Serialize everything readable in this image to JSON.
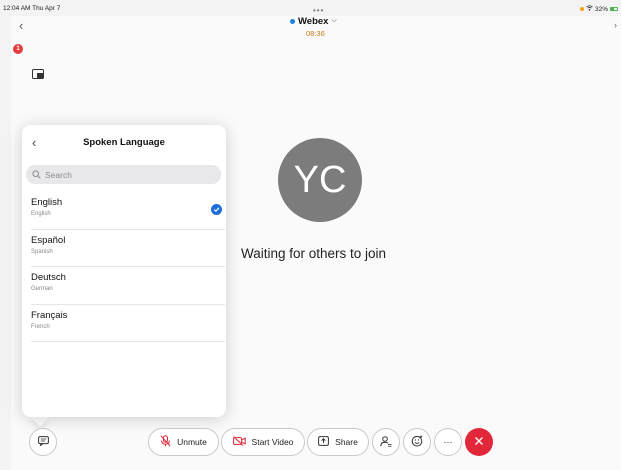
{
  "status_bar": {
    "time": "12:04 AM  Thu Apr 7",
    "battery": "32%"
  },
  "header": {
    "title": "Webex",
    "timer": "08:36",
    "badge_count": "1"
  },
  "center": {
    "avatar_initials": "YC",
    "waiting_text": "Waiting for others to join"
  },
  "language_panel": {
    "title": "Spoken Language",
    "search_placeholder": "Search",
    "languages": [
      {
        "name": "English",
        "sub": "English",
        "selected": true
      },
      {
        "name": "Español",
        "sub": "Spanish",
        "selected": false
      },
      {
        "name": "Deutsch",
        "sub": "German",
        "selected": false
      },
      {
        "name": "Français",
        "sub": "French",
        "selected": false
      }
    ]
  },
  "toolbar": {
    "unmute_label": "Unmute",
    "start_video_label": "Start Video",
    "share_label": "Share",
    "more_label": "···"
  },
  "colors": {
    "accent": "#1c6fd8",
    "end_call": "#e0283a",
    "mute_red": "#e0283a",
    "timer": "#c57a15"
  }
}
